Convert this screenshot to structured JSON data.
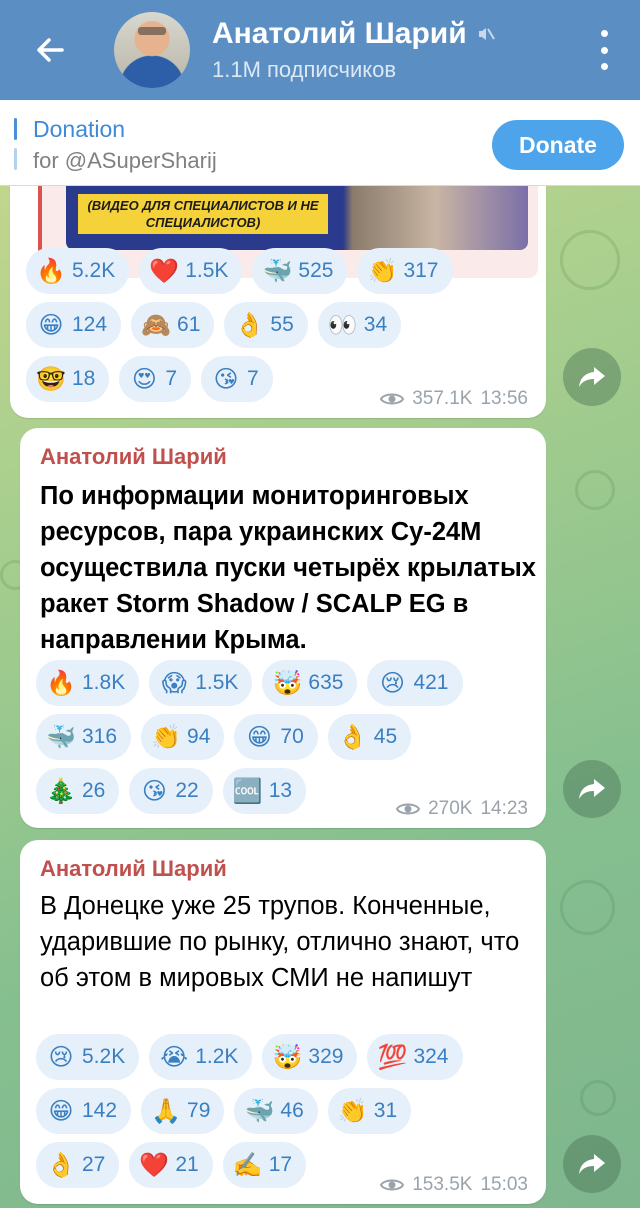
{
  "header": {
    "title": "Анатолий Шарий",
    "subscribers": "1.1M подписчиков",
    "muted_icon": "muted-speaker-icon",
    "back_icon": "arrow-left-icon",
    "menu_icon": "more-vertical-icon",
    "color": "#5b8fc4"
  },
  "pinned": {
    "title": "Donation",
    "subtitle": "for @ASuperSharij",
    "button_label": "Donate",
    "button_color": "#4ea4ea"
  },
  "messages": [
    {
      "media_caption": "(ВИДЕО ДЛЯ СПЕЦИАЛИСТОВ И НЕ СПЕЦИАЛИСТОВ)",
      "reactions": [
        {
          "emoji": "🔥",
          "count": "5.2K"
        },
        {
          "emoji": "❤️",
          "count": "1.5K"
        },
        {
          "emoji": "🐳",
          "count": "525"
        },
        {
          "emoji": "👏",
          "count": "317"
        },
        {
          "emoji": "😁",
          "count": "124"
        },
        {
          "emoji": "🙈",
          "count": "61"
        },
        {
          "emoji": "👌",
          "count": "55"
        },
        {
          "emoji": "👀",
          "count": "34"
        },
        {
          "emoji": "🤓",
          "count": "18"
        },
        {
          "emoji": "😍",
          "count": "7"
        },
        {
          "emoji": "😘",
          "count": "7"
        }
      ],
      "views": "357.1K",
      "time": "13:56"
    },
    {
      "sender": "Анатолий Шарий",
      "text": "По информации мониторинговых ресурсов, пара украинских Су-24М осуществила пуски четырёх крылатых ракет Storm Shadow / SCALP EG в направлении Крыма.",
      "reactions": [
        {
          "emoji": "🔥",
          "count": "1.8K"
        },
        {
          "emoji": "😱",
          "count": "1.5K"
        },
        {
          "emoji": "🤯",
          "count": "635"
        },
        {
          "emoji": "😢",
          "count": "421"
        },
        {
          "emoji": "🐳",
          "count": "316"
        },
        {
          "emoji": "👏",
          "count": "94"
        },
        {
          "emoji": "😁",
          "count": "70"
        },
        {
          "emoji": "👌",
          "count": "45"
        },
        {
          "emoji": "🎄",
          "count": "26"
        },
        {
          "emoji": "😘",
          "count": "22"
        },
        {
          "emoji": "🆒",
          "count": "13"
        }
      ],
      "views": "270K",
      "time": "14:23"
    },
    {
      "sender": "Анатолий Шарий",
      "text": "В Донецке уже 25 трупов. Конченные, ударившие по рынку, отлично знают, что об этом в мировых СМИ не напишут",
      "reactions": [
        {
          "emoji": "😢",
          "count": "5.2K"
        },
        {
          "emoji": "😭",
          "count": "1.2K"
        },
        {
          "emoji": "🤯",
          "count": "329"
        },
        {
          "emoji": "💯",
          "count": "324"
        },
        {
          "emoji": "😁",
          "count": "142"
        },
        {
          "emoji": "🙏",
          "count": "79"
        },
        {
          "emoji": "🐳",
          "count": "46"
        },
        {
          "emoji": "👏",
          "count": "31"
        },
        {
          "emoji": "👌",
          "count": "27"
        },
        {
          "emoji": "❤️",
          "count": "21"
        },
        {
          "emoji": "✍️",
          "count": "17"
        }
      ],
      "views": "153.5K",
      "time": "15:03"
    }
  ],
  "colors": {
    "sender": "#c0504d",
    "reaction_bg": "#e5f0fb",
    "reaction_text": "#3a7fc1"
  }
}
